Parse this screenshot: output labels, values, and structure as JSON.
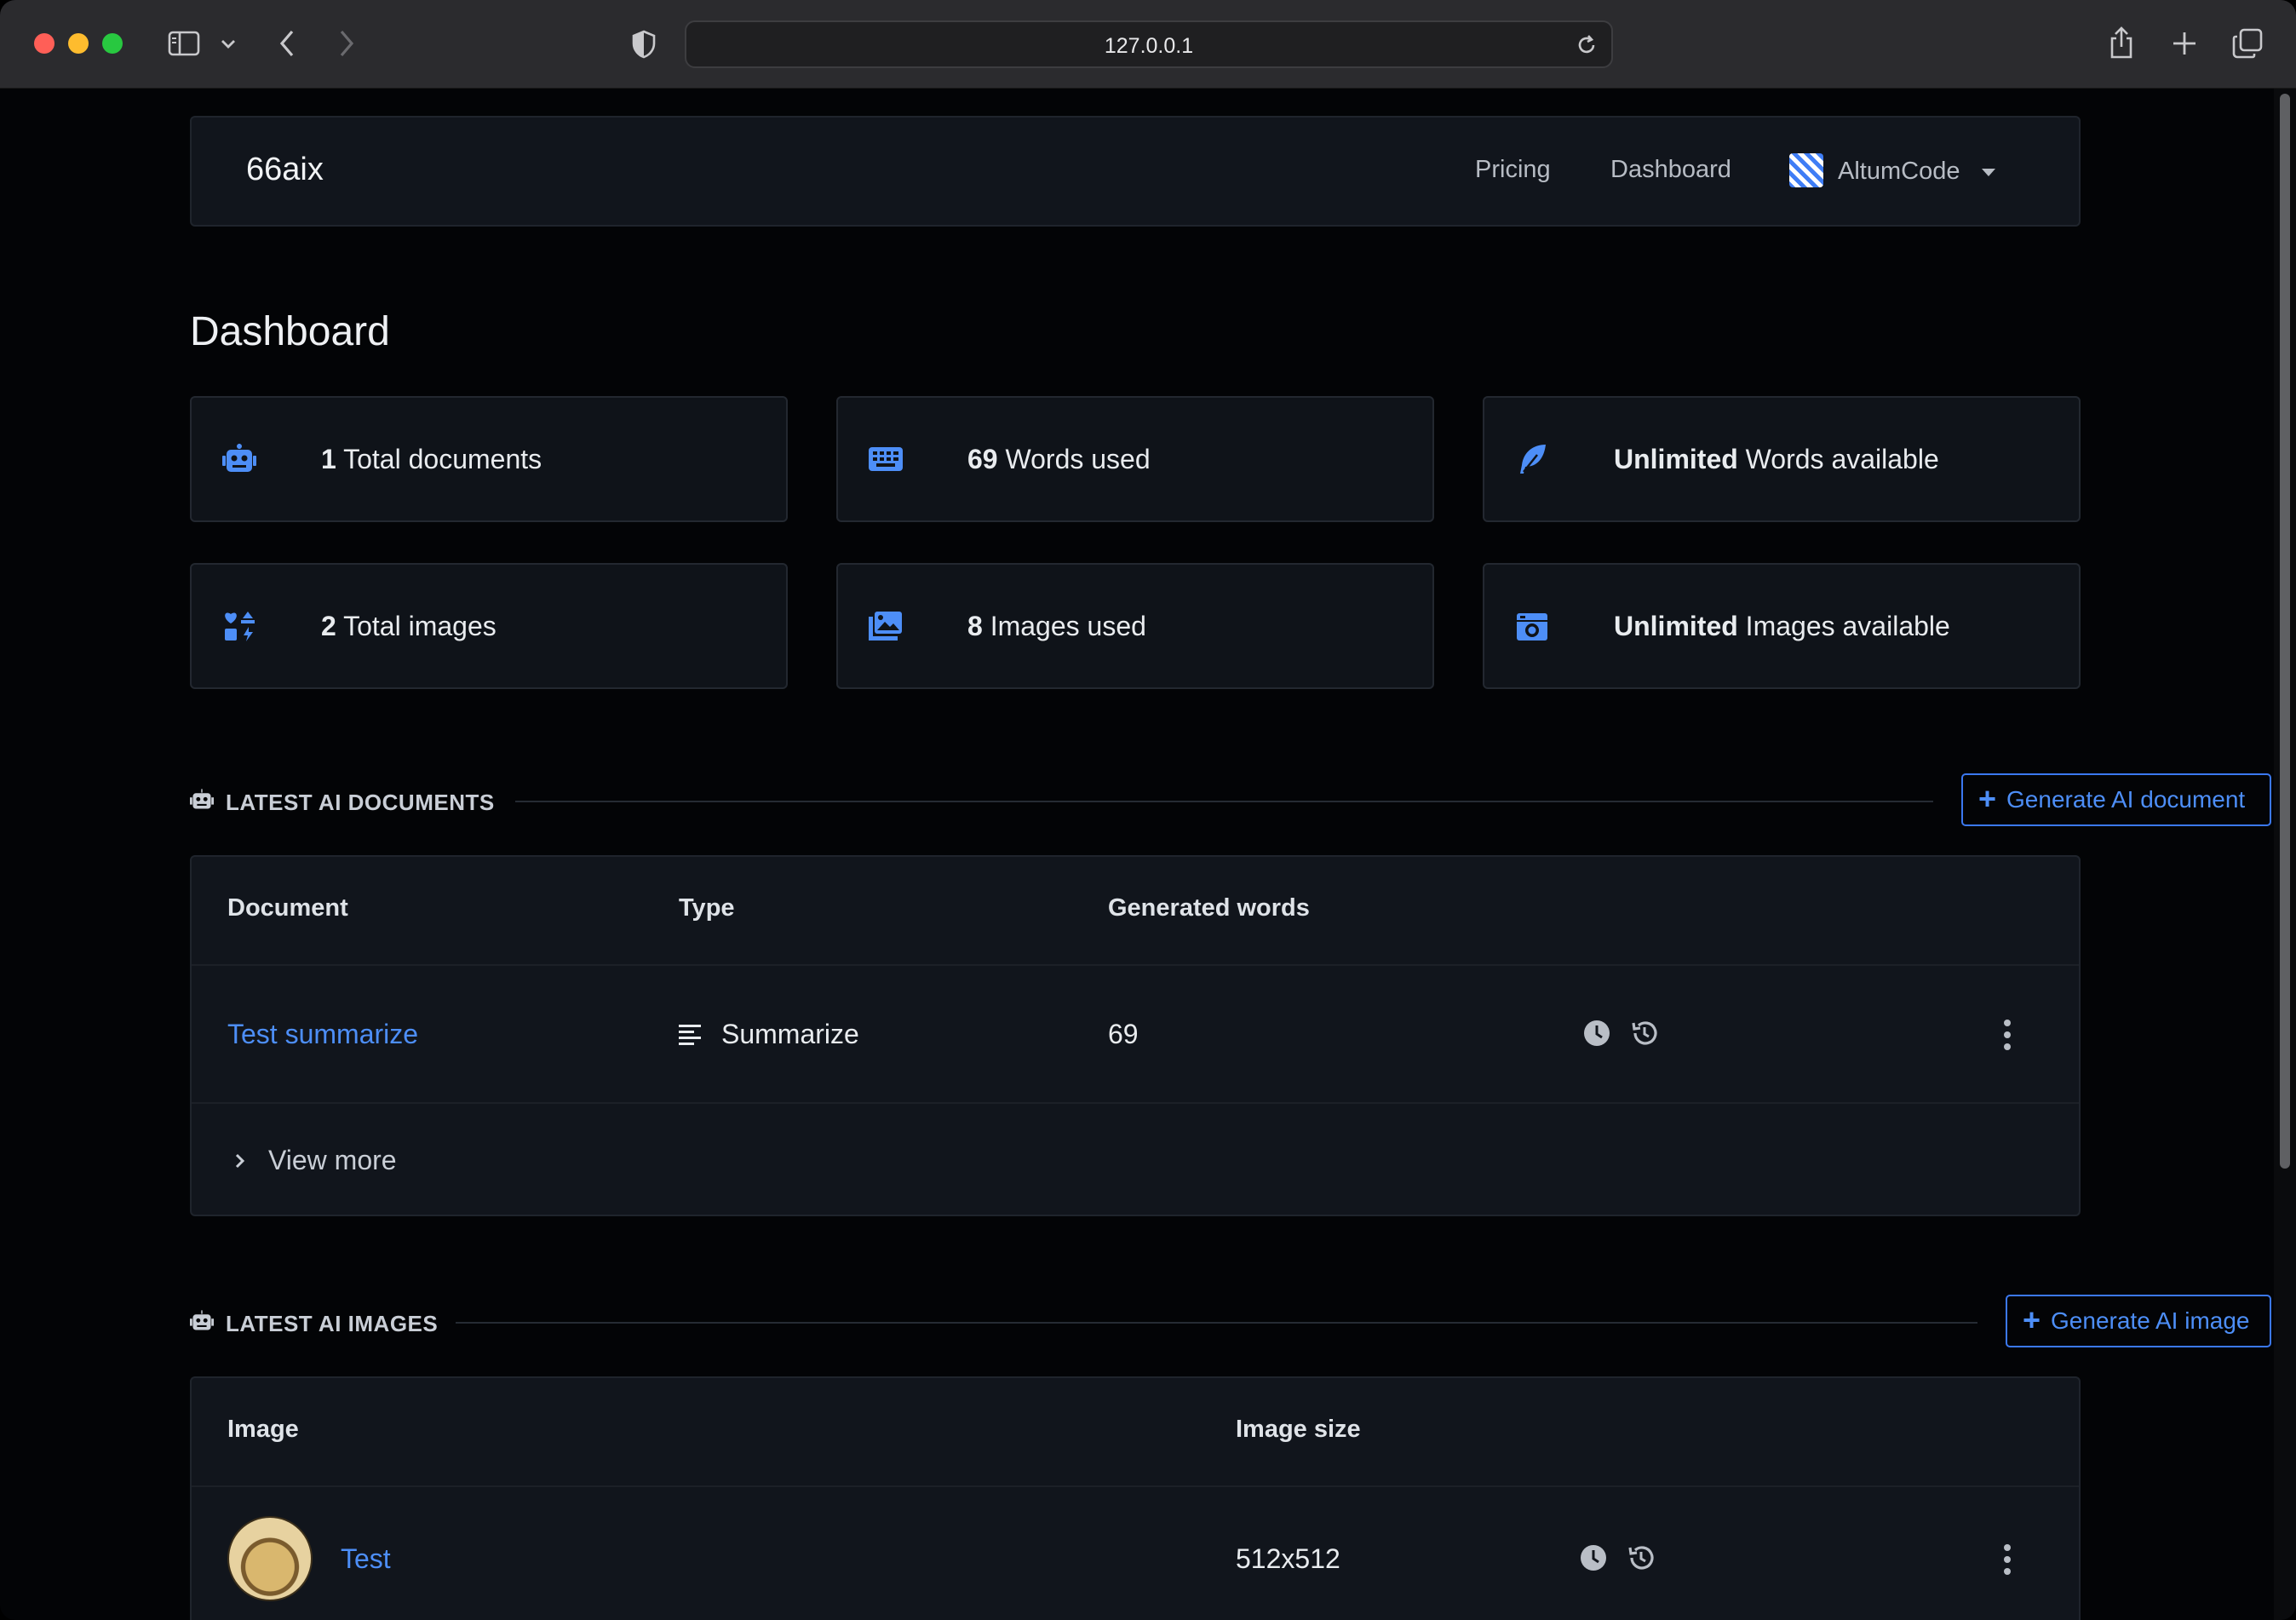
{
  "browser": {
    "address": "127.0.0.1"
  },
  "navbar": {
    "brand": "66aix",
    "links": [
      "Pricing",
      "Dashboard"
    ],
    "user": "AltumCode"
  },
  "page": {
    "title": "Dashboard"
  },
  "stats": [
    {
      "value": "1",
      "label": "Total documents",
      "icon": "robot-icon"
    },
    {
      "value": "69",
      "label": "Words used",
      "icon": "keyboard-icon"
    },
    {
      "value": "Unlimited",
      "label": "Words available",
      "icon": "feather-icon"
    },
    {
      "value": "2",
      "label": "Total images",
      "icon": "icons-grid-icon"
    },
    {
      "value": "8",
      "label": "Images used",
      "icon": "images-icon"
    },
    {
      "value": "Unlimited",
      "label": "Images available",
      "icon": "camera-retro-icon"
    }
  ],
  "documents": {
    "section_title": "LATEST AI DOCUMENTS",
    "button": "Generate AI document",
    "columns": [
      "Document",
      "Type",
      "Generated words"
    ],
    "rows": [
      {
        "name": "Test summarize",
        "type": "Summarize",
        "words": "69"
      }
    ],
    "view_more": "View more"
  },
  "images": {
    "section_title": "LATEST AI IMAGES",
    "button": "Generate AI image",
    "columns": [
      "Image",
      "Image size"
    ],
    "rows": [
      {
        "name": "Test",
        "size": "512x512"
      }
    ]
  },
  "colors": {
    "accent": "#4d8ef7",
    "background": "#030406",
    "card": "#11151c"
  }
}
